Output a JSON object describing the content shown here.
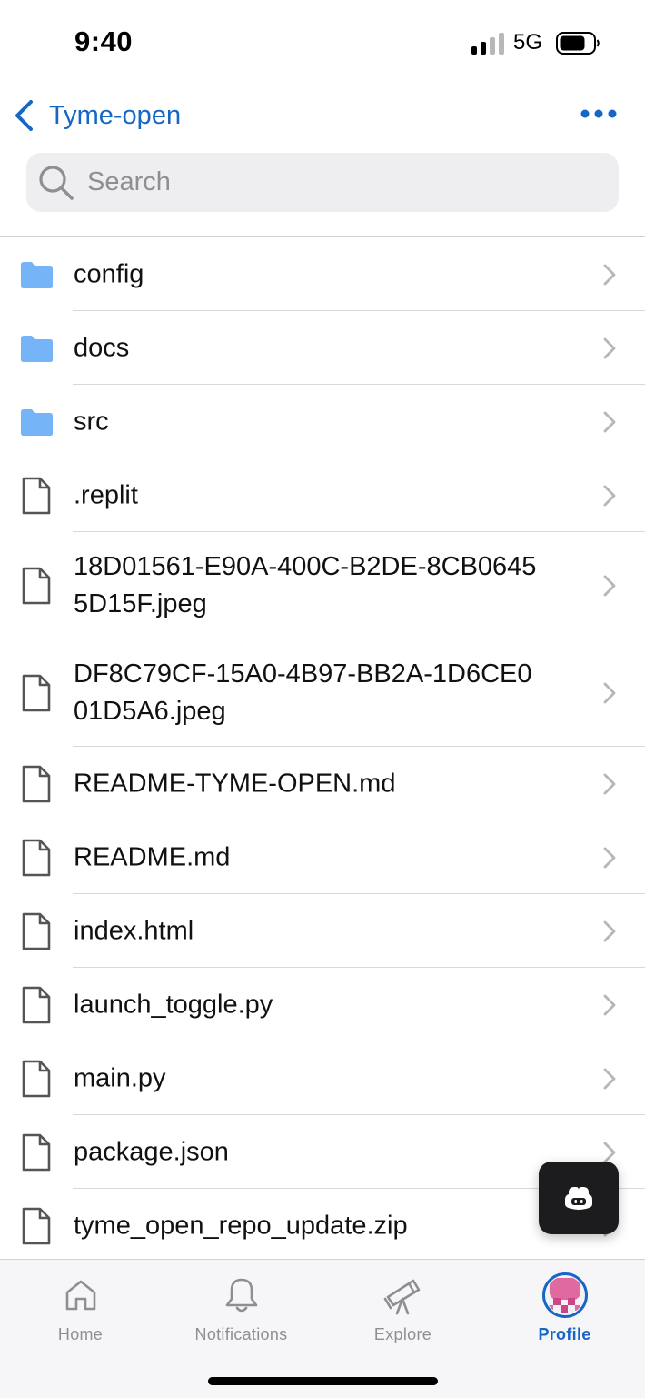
{
  "status_bar": {
    "time": "9:40",
    "network": "5G",
    "signal_bars_active": 2,
    "signal_bars_total": 4,
    "battery_level": 0.7
  },
  "nav": {
    "back_label": "Tyme-open",
    "back_icon": "chevron-left-icon",
    "more_icon": "ellipsis-icon"
  },
  "search": {
    "placeholder": "Search",
    "icon": "search-icon"
  },
  "files": [
    {
      "name": "config",
      "type": "folder"
    },
    {
      "name": "docs",
      "type": "folder"
    },
    {
      "name": "src",
      "type": "folder"
    },
    {
      "name": ".replit",
      "type": "file"
    },
    {
      "name": "18D01561-E90A-400C-B2DE-8CB06455D15F.jpeg",
      "type": "file"
    },
    {
      "name": "DF8C79CF-15A0-4B97-BB2A-1D6CE001D5A6.jpeg",
      "type": "file"
    },
    {
      "name": "README-TYME-OPEN.md",
      "type": "file"
    },
    {
      "name": "README.md",
      "type": "file"
    },
    {
      "name": "index.html",
      "type": "file"
    },
    {
      "name": "launch_toggle.py",
      "type": "file"
    },
    {
      "name": "main.py",
      "type": "file"
    },
    {
      "name": "package.json",
      "type": "file"
    },
    {
      "name": "tyme_open_repo_update.zip",
      "type": "file"
    }
  ],
  "tabs": [
    {
      "label": "Home",
      "icon": "home-icon",
      "active": false
    },
    {
      "label": "Notifications",
      "icon": "bell-icon",
      "active": false
    },
    {
      "label": "Explore",
      "icon": "telescope-icon",
      "active": false
    },
    {
      "label": "Profile",
      "icon": "avatar",
      "active": true
    }
  ],
  "colors": {
    "accent": "#1667c5",
    "folder": "#74b4f7",
    "inactive_tab": "#8e8e93"
  }
}
